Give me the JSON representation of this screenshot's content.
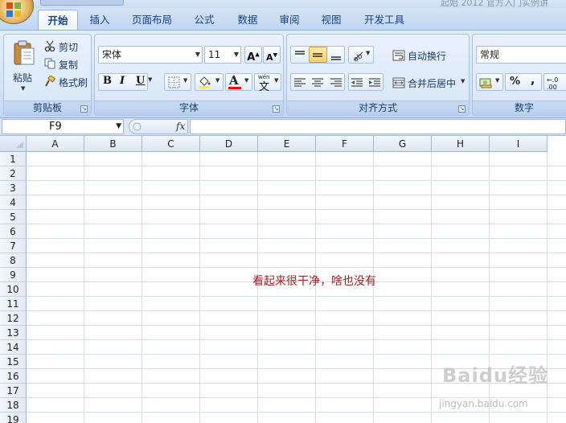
{
  "window": {
    "title": "起始 2012 官方入门实例讲"
  },
  "tabs": [
    {
      "label": "开始",
      "active": true
    },
    {
      "label": "插入"
    },
    {
      "label": "页面布局"
    },
    {
      "label": "公式"
    },
    {
      "label": "数据"
    },
    {
      "label": "审阅"
    },
    {
      "label": "视图"
    },
    {
      "label": "开发工具"
    }
  ],
  "clipboard": {
    "paste_label": "粘贴",
    "cut_label": "剪切",
    "copy_label": "复制",
    "format_painter_label": "格式刷",
    "group_label": "剪贴板"
  },
  "font": {
    "font_name": "宋体",
    "font_size": "11",
    "bold": "B",
    "italic": "I",
    "underline": "U",
    "phonetic": "wén",
    "phonetic_char": "文",
    "font_color_letter": "A",
    "group_label": "字体",
    "highlight_color": "#ffff00",
    "font_color": "#ff0000"
  },
  "alignment": {
    "wrap_text_label": "自动换行",
    "merge_center_label": "合并后居中",
    "group_label": "对齐方式"
  },
  "number": {
    "format": "常规",
    "percent": "%",
    "comma": ",",
    "group_label": "数字"
  },
  "formula_bar": {
    "name_box": "F9",
    "fx": "fx",
    "content": ""
  },
  "columns": [
    "A",
    "B",
    "C",
    "D",
    "E",
    "F",
    "G",
    "H",
    "I"
  ],
  "rows": [
    "1",
    "2",
    "3",
    "4",
    "5",
    "6",
    "7",
    "8",
    "9",
    "10",
    "11",
    "12",
    "13",
    "14",
    "15",
    "16",
    "17",
    "18",
    "19"
  ],
  "cell_note": "看起来很干净，啥也没有",
  "watermark": {
    "logo": "Baidu经验",
    "url": "jingyan.baidu.com"
  }
}
